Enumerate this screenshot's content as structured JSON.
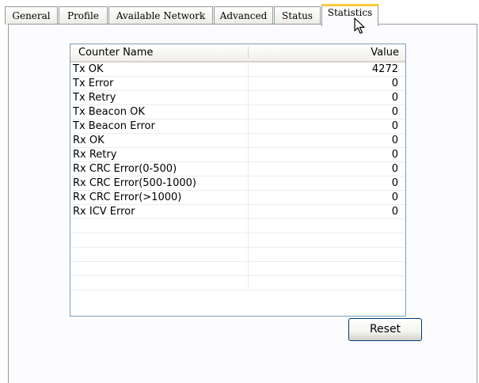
{
  "tabs": [
    {
      "label": "General"
    },
    {
      "label": "Profile"
    },
    {
      "label": "Available Network"
    },
    {
      "label": "Advanced"
    },
    {
      "label": "Status"
    },
    {
      "label": "Statistics"
    }
  ],
  "active_tab": "Statistics",
  "table": {
    "columns": [
      "Counter Name",
      "Value"
    ],
    "rows": [
      {
        "name": "Tx OK",
        "value": "4272"
      },
      {
        "name": "Tx Error",
        "value": "0"
      },
      {
        "name": "Tx Retry",
        "value": "0"
      },
      {
        "name": "Tx Beacon OK",
        "value": "0"
      },
      {
        "name": "Tx Beacon Error",
        "value": "0"
      },
      {
        "name": "Rx OK",
        "value": "0"
      },
      {
        "name": "Rx Retry",
        "value": "0"
      },
      {
        "name": "Rx CRC Error(0-500)",
        "value": "0"
      },
      {
        "name": "Rx CRC Error(500-1000)",
        "value": "0"
      },
      {
        "name": "Rx CRC Error(>1000)",
        "value": "0"
      },
      {
        "name": "Rx ICV Error",
        "value": "0"
      }
    ]
  },
  "buttons": {
    "reset_label": "Reset"
  },
  "colors": {
    "active_tab_accent": "#ffc83c",
    "border": "#919b9c",
    "list_border": "#7f9db9",
    "button_border": "#003c74"
  },
  "icons": {
    "cursor": "arrow-cursor-icon"
  }
}
